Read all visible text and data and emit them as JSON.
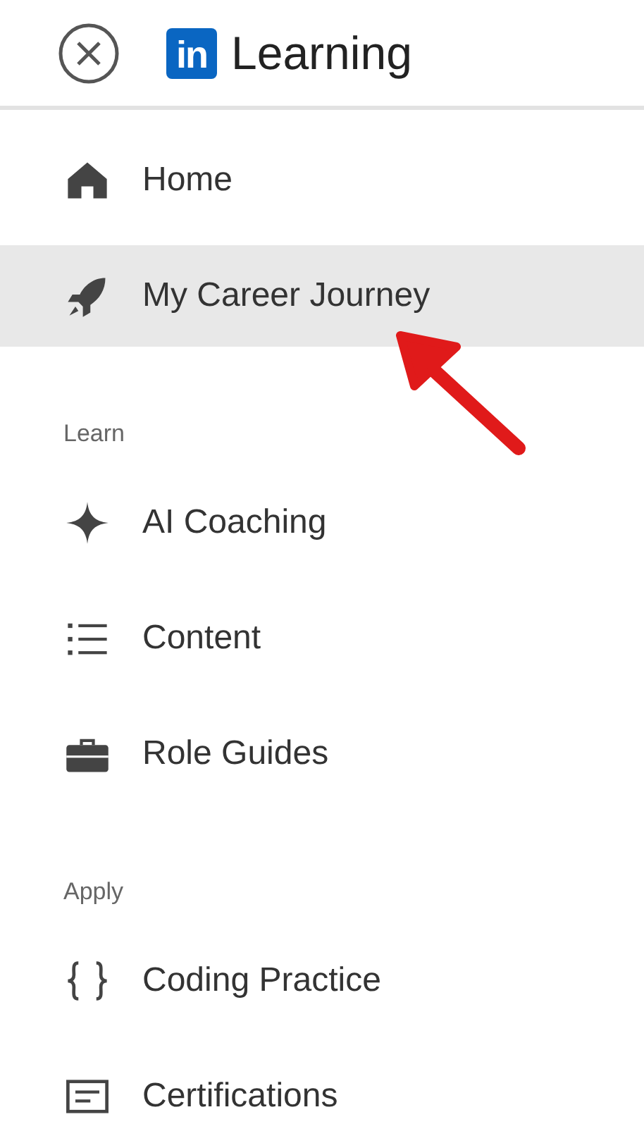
{
  "header": {
    "logo_mark": "in",
    "logo_text": "Learning"
  },
  "sections": [
    {
      "items": [
        {
          "label": "Home",
          "kind": "home",
          "selected": false
        },
        {
          "label": "My Career Journey",
          "kind": "rocket",
          "selected": true
        }
      ]
    },
    {
      "title": "Learn",
      "items": [
        {
          "label": "AI Coaching",
          "kind": "sparkle",
          "selected": false
        },
        {
          "label": "Content",
          "kind": "list",
          "selected": false
        },
        {
          "label": "Role Guides",
          "kind": "briefcase",
          "selected": false
        }
      ]
    },
    {
      "title": "Apply",
      "items": [
        {
          "label": "Coding Practice",
          "kind": "braces",
          "selected": false
        },
        {
          "label": "Certifications",
          "kind": "certificate",
          "selected": false
        }
      ]
    }
  ]
}
